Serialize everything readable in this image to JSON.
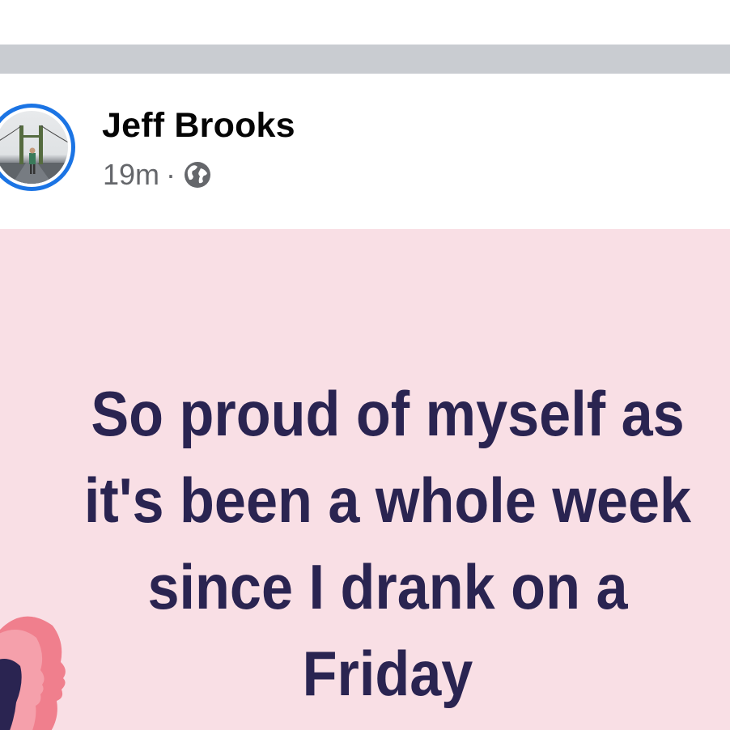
{
  "post": {
    "author": "Jeff Brooks",
    "timestamp": "19m",
    "separator": "·",
    "audience_icon": "globe-icon",
    "text": "So proud of myself as\nit's been a whole week\nsince I drank on a\nFriday"
  },
  "colors": {
    "story_ring": "#1b74e4",
    "post_background": "#f9dfe5",
    "post_text": "#2a2451",
    "divider": "#c9ccd1"
  }
}
